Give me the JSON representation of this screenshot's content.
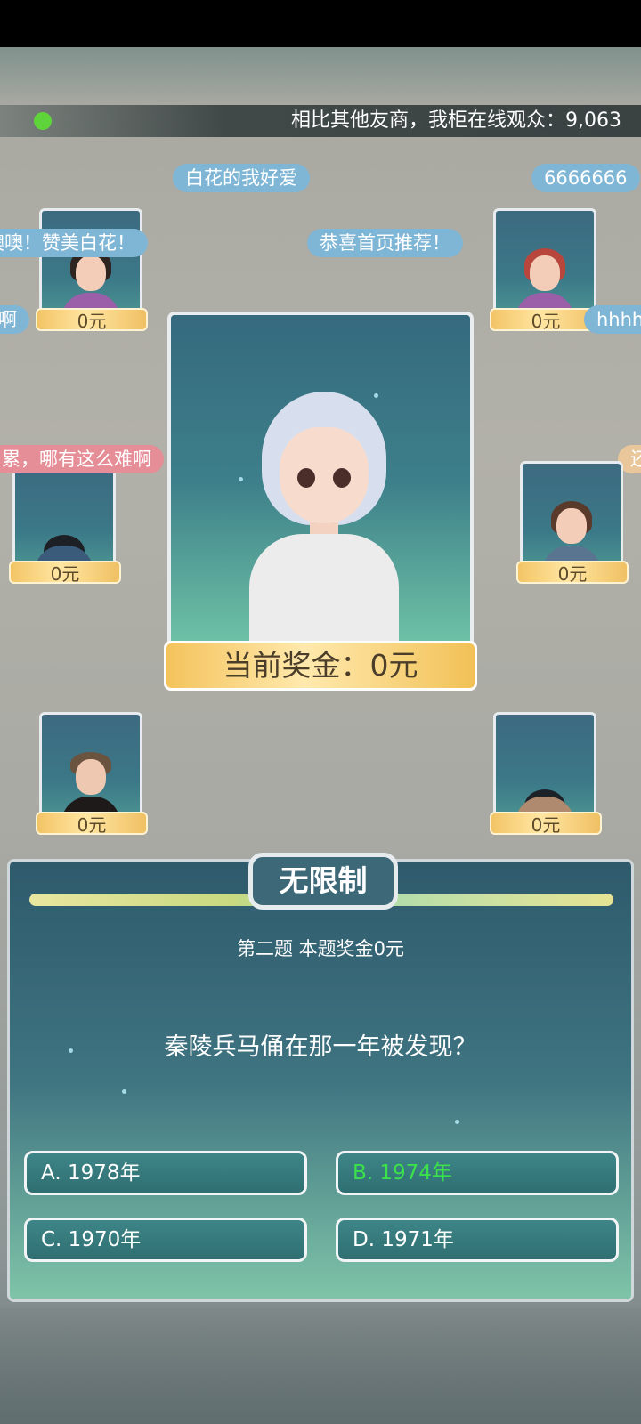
{
  "header": {
    "viewers_text": "相比其他友商，我柜在线观众：9,063"
  },
  "comments": [
    {
      "text": "白花的我好爱",
      "style": "blue"
    },
    {
      "text": "6666666",
      "style": "blue"
    },
    {
      "text": "噢噢！赞美白花！",
      "style": "blue"
    },
    {
      "text": "恭喜首页推荐！",
      "style": "blue"
    },
    {
      "text": "啊",
      "style": "blue"
    },
    {
      "text": "hhhh",
      "style": "blue"
    },
    {
      "text": "累，哪有这么难啊",
      "style": "pink"
    },
    {
      "text": "还",
      "style": "gold"
    }
  ],
  "players": [
    {
      "money": "0元",
      "active": false
    },
    {
      "money": "0元",
      "active": false
    },
    {
      "money": "0元",
      "active": true
    },
    {
      "money": "0元",
      "active": false
    },
    {
      "money": "0元",
      "active": false
    },
    {
      "money": "0元",
      "active": true
    }
  ],
  "host": {
    "prize_text": "当前奖金：0元"
  },
  "question_panel": {
    "mode_label": "无限制",
    "question_info": "第二题 本题奖金0元",
    "question_text": "秦陵兵马俑在那一年被发现？",
    "answers": [
      {
        "label": "A. 1978年",
        "correct": false
      },
      {
        "label": "B. 1974年",
        "correct": true
      },
      {
        "label": "C. 1970年",
        "correct": false
      },
      {
        "label": "D. 1971年",
        "correct": false
      }
    ]
  },
  "colors": {
    "live_indicator": "#5fd43a",
    "correct_answer": "#3be04a",
    "active_player_border": "#7ad33d"
  }
}
